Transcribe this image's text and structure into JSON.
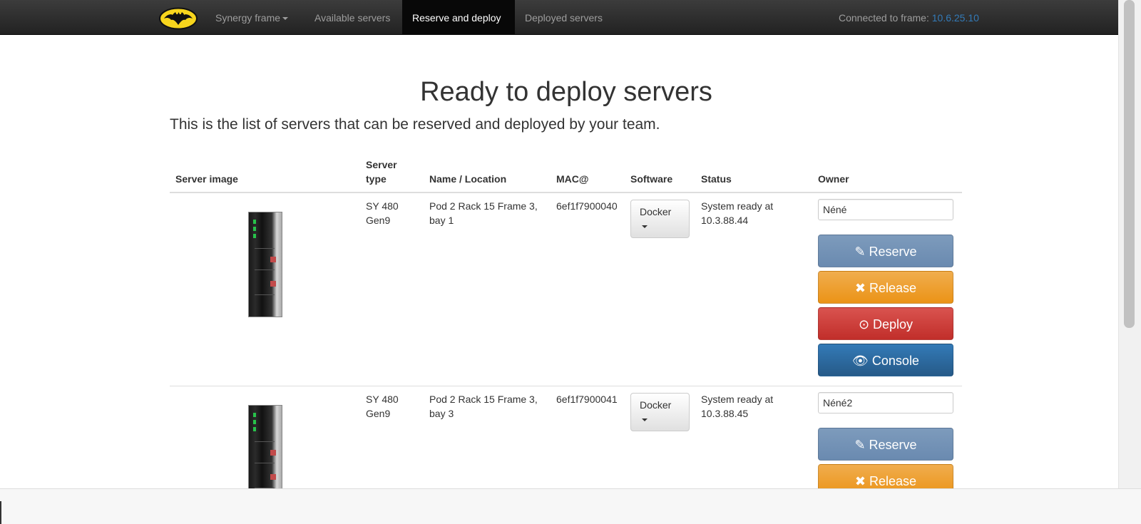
{
  "navbar": {
    "brand": "batman-logo",
    "items": [
      {
        "label": "Synergy frame"
      },
      {
        "label": "Available servers"
      },
      {
        "label": "Reserve and deploy"
      },
      {
        "label": "Deployed servers"
      }
    ],
    "connected_label": "Connected to frame: ",
    "connected_ip": "10.6.25.10"
  },
  "page": {
    "title": "Ready to deploy servers",
    "lead": "This is the list of servers that can be reserved and deployed by your team."
  },
  "table": {
    "headers": {
      "image": "Server image",
      "type_line1": "Server",
      "type_line2": "type",
      "name": "Name / Location",
      "mac": "MAC@",
      "software": "Software",
      "status": "Status",
      "owner": "Owner"
    },
    "rows": [
      {
        "type": "SY 480 Gen9",
        "name": "Pod 2 Rack 15 Frame 3, bay 1",
        "mac": "6ef1f7900040",
        "software": "Docker",
        "status": "System ready at 10.3.88.44",
        "owner": "Néné"
      },
      {
        "type": "SY 480 Gen9",
        "name": "Pod 2 Rack 15 Frame 3, bay 3",
        "mac": "6ef1f7900041",
        "software": "Docker",
        "status": "System ready at 10.3.88.45",
        "owner": "Néné2"
      }
    ]
  },
  "actions": {
    "reserve": "Reserve",
    "release": "Release",
    "deploy": "Deploy",
    "console": "Console"
  },
  "colors": {
    "navbar": "#222222",
    "reserve": "#7193b8",
    "release": "#f0a31e",
    "deploy": "#d33b36",
    "console": "#2e6da4",
    "link": "#337ab7"
  }
}
